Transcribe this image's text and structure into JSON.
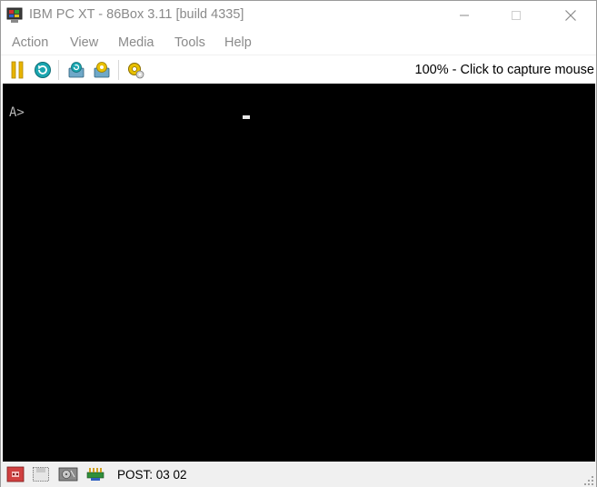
{
  "window": {
    "title": "IBM PC XT - 86Box 3.11 [build 4335]",
    "app_icon": "86box-app-icon",
    "controls": {
      "minimize": "minimize-icon",
      "maximize": "maximize-icon",
      "close": "close-icon"
    }
  },
  "menubar": {
    "items": [
      {
        "label": "Action"
      },
      {
        "label": "View"
      },
      {
        "label": "Media"
      },
      {
        "label": "Tools"
      },
      {
        "label": "Help"
      }
    ]
  },
  "toolbar": {
    "buttons": [
      {
        "name": "pause",
        "icon": "pause-icon"
      },
      {
        "name": "reset",
        "icon": "reset-icon"
      },
      {
        "name": "ctrl-alt-del",
        "icon": "ctrl-alt-del-icon"
      },
      {
        "name": "ctrl-alt-esc",
        "icon": "ctrl-alt-esc-icon"
      },
      {
        "name": "settings",
        "icon": "settings-gear-icon"
      }
    ],
    "capture_text": "100% - Click to capture mouse"
  },
  "screen": {
    "prompt": "A>"
  },
  "statusbar": {
    "icons": [
      {
        "name": "cassette",
        "icon": "cassette-icon"
      },
      {
        "name": "floppy",
        "icon": "floppy-icon"
      },
      {
        "name": "hard-disk",
        "icon": "hard-disk-icon"
      },
      {
        "name": "network",
        "icon": "network-icon"
      }
    ],
    "post_text": "POST: 03 02"
  },
  "colors": {
    "accent_yellow": "#e8b400",
    "accent_teal": "#1aa6b0",
    "screen_bg": "#000000",
    "dos_text": "#b8b8b8",
    "title_gray": "#8a8a8a",
    "statusbar_bg": "#f0f0f0"
  }
}
